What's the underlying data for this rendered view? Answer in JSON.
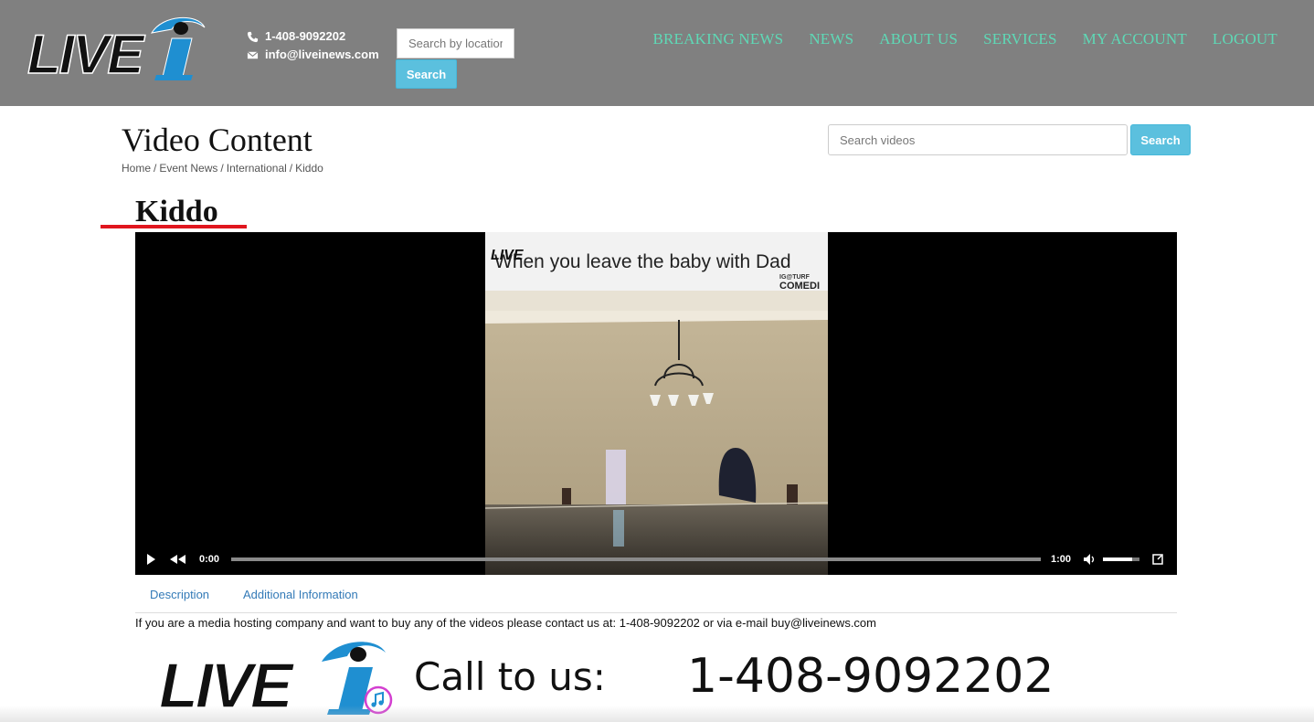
{
  "header": {
    "logo_text": "LIVE",
    "phone": "1-408-9092202",
    "email": "info@liveinews.com",
    "location_search": {
      "placeholder": "Search by location",
      "button_label": "Search"
    },
    "nav": [
      "BREAKING NEWS",
      "NEWS",
      "ABOUT US",
      "SERVICES",
      "MY ACCOUNT",
      "LOGOUT"
    ],
    "colors": {
      "bar": "#808080",
      "nav_link": "#5ed9b6",
      "accent_button": "#5bc0de"
    }
  },
  "page": {
    "title": "Video Content",
    "breadcrumb": [
      "Home",
      "Event News",
      "International",
      "Kiddo"
    ],
    "video_search": {
      "placeholder": "Search videos",
      "button_label": "Search"
    }
  },
  "video": {
    "title": "Kiddo",
    "caption": "When you leave the baby with Dad",
    "watermark_top": "IG@TURF",
    "watermark_bottom": "COMEDI",
    "current_time": "0:00",
    "duration": "1:00",
    "progress": 0,
    "volume": 0.8
  },
  "tabs": [
    "Description",
    "Additional Information"
  ],
  "notice": "If you are a media hosting company and want to buy any of the videos please contact us at: 1-408-9092202 or via e-mail buy@liveinews.com",
  "banner": {
    "logo_text": "LIVE",
    "call_label": "Call to us:",
    "call_number": "1-408-9092202"
  }
}
